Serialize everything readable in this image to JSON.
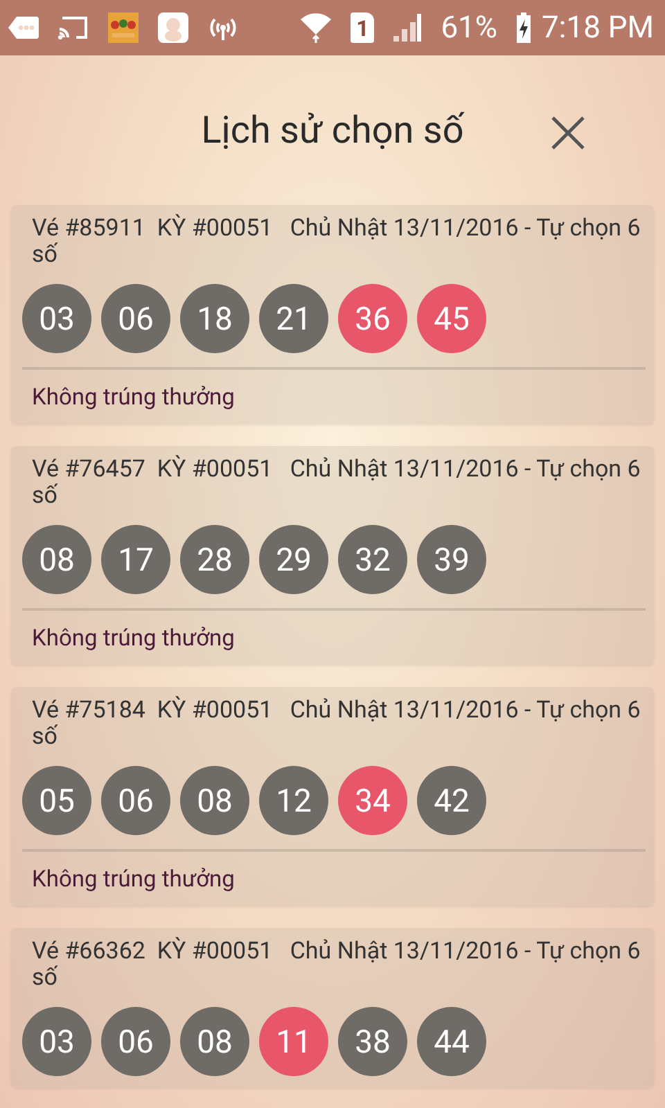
{
  "status_bar": {
    "sim_slot": "1",
    "battery": "61%",
    "time": "7:18 PM"
  },
  "header": {
    "title": "Lịch sử chọn số"
  },
  "tickets": [
    {
      "info": "Vé #85911  KỲ #00051   Chủ Nhật 13/11/2016 - Tự chọn 6 số",
      "numbers": [
        {
          "value": "03",
          "matched": false
        },
        {
          "value": "06",
          "matched": false
        },
        {
          "value": "18",
          "matched": false
        },
        {
          "value": "21",
          "matched": false
        },
        {
          "value": "36",
          "matched": true
        },
        {
          "value": "45",
          "matched": true
        }
      ],
      "result": "Không trúng thưởng"
    },
    {
      "info": "Vé #76457  KỲ #00051   Chủ Nhật 13/11/2016 - Tự chọn 6 số",
      "numbers": [
        {
          "value": "08",
          "matched": false
        },
        {
          "value": "17",
          "matched": false
        },
        {
          "value": "28",
          "matched": false
        },
        {
          "value": "29",
          "matched": false
        },
        {
          "value": "32",
          "matched": false
        },
        {
          "value": "39",
          "matched": false
        }
      ],
      "result": "Không trúng thưởng"
    },
    {
      "info": "Vé #75184  KỲ #00051   Chủ Nhật 13/11/2016 - Tự chọn 6 số",
      "numbers": [
        {
          "value": "05",
          "matched": false
        },
        {
          "value": "06",
          "matched": false
        },
        {
          "value": "08",
          "matched": false
        },
        {
          "value": "12",
          "matched": false
        },
        {
          "value": "34",
          "matched": true
        },
        {
          "value": "42",
          "matched": false
        }
      ],
      "result": "Không trúng thưởng"
    },
    {
      "info": "Vé #66362  KỲ #00051   Chủ Nhật 13/11/2016 - Tự chọn 6 số",
      "numbers": [
        {
          "value": "03",
          "matched": false
        },
        {
          "value": "06",
          "matched": false
        },
        {
          "value": "08",
          "matched": false
        },
        {
          "value": "11",
          "matched": true
        },
        {
          "value": "38",
          "matched": false
        },
        {
          "value": "44",
          "matched": false
        }
      ]
    }
  ]
}
